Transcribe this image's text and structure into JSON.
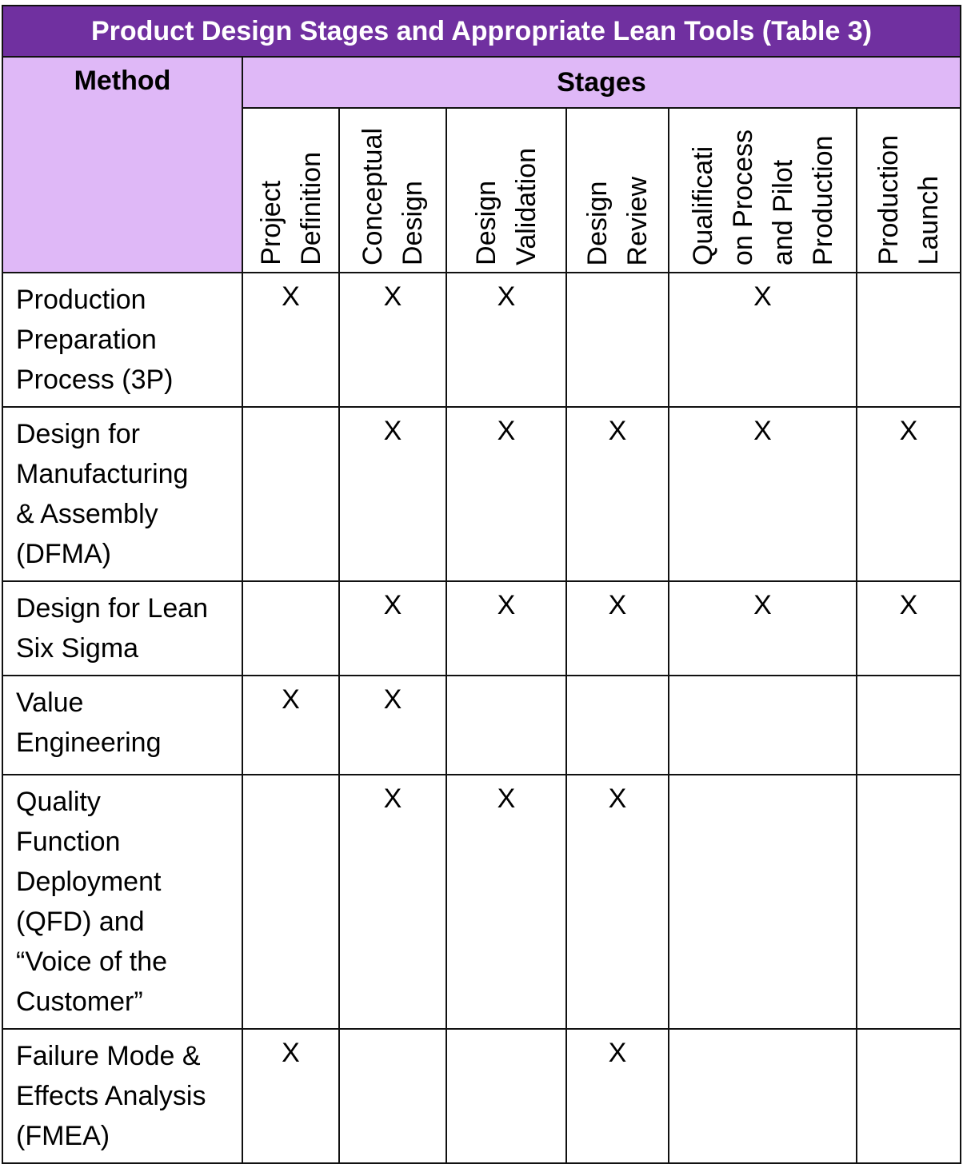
{
  "title": "Product Design Stages and Appropriate Lean Tools (Table 3)",
  "method_header": "Method",
  "stages_header": "Stages",
  "stages": [
    "Project\nDefinition",
    "Conceptual\nDesign",
    "Design\nValidation",
    "Design\nReview",
    "Qualificati\non Process\nand Pilot\nProduction",
    "Production\nLaunch"
  ],
  "rows": [
    {
      "method": "Production\nPreparation\nProcess (3P)",
      "marks": [
        "X",
        "X",
        "X",
        "",
        "X",
        ""
      ]
    },
    {
      "method": "Design for\nManufacturing\n& Assembly\n(DFMA)",
      "marks": [
        "",
        "X",
        "X",
        "X",
        "X",
        "X"
      ]
    },
    {
      "method": "Design for Lean\nSix Sigma",
      "marks": [
        "",
        "X",
        "X",
        "X",
        "X",
        "X"
      ]
    },
    {
      "method": "Value\nEngineering",
      "marks": [
        "X",
        "X",
        "",
        "",
        "",
        ""
      ]
    },
    {
      "method": "Quality\nFunction\nDeployment\n(QFD) and\n“Voice of the\nCustomer”",
      "marks": [
        "",
        "X",
        "X",
        "X",
        "",
        ""
      ]
    },
    {
      "method": "Failure Mode &\nEffects Analysis\n(FMEA)",
      "marks": [
        "X",
        "",
        "",
        "X",
        "",
        ""
      ]
    }
  ],
  "colors": {
    "title_bg": "#7030a0",
    "header_bg": "#dfb8f7"
  }
}
